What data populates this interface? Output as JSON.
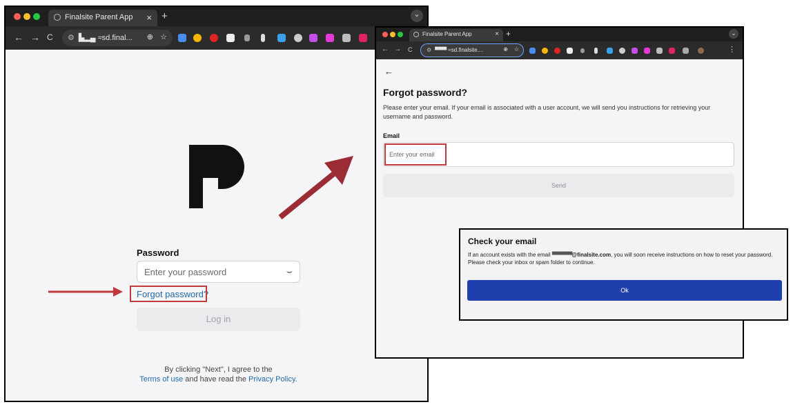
{
  "browser": {
    "tab_title": "Finalsite Parent App",
    "tab_close": "×",
    "new_tab": "+",
    "menu_chevron": "⌄",
    "url_left": "▙▂▄ ≈sd.final...",
    "url_right": "▀▀▀ ≈sd.finalsite....",
    "back_glyph": "←",
    "forward_glyph": "→",
    "reload_glyph": "C",
    "zoom_glyph": "⊕",
    "star_glyph": "☆",
    "kebab_glyph": "⋮"
  },
  "login": {
    "password_label": "Password",
    "password_placeholder": "Enter your password",
    "eye_glyph": "⌣",
    "forgot_link": "Forgot password?",
    "login_button": "Log in",
    "footer_line1": "By clicking \"Next\", I agree to the",
    "terms_link": "Terms of use",
    "footer_mid": " and have read the ",
    "privacy_link": "Privacy Policy",
    "footer_end": "."
  },
  "forgot": {
    "back_glyph": "←",
    "title": "Forgot password?",
    "description": "Please enter your email. If your email is associated with a user account, we will send you instructions for retrieving your username and password.",
    "email_label": "Email",
    "email_placeholder": "Enter your email",
    "send_button": "Send"
  },
  "check": {
    "title": "Check your email",
    "text_before": "If an account exists with the email ",
    "email_redacted": "▀▀▀'▀▀▀",
    "email_domain": "@finalsite.com",
    "text_after": ", you will soon receive instructions on how to reset your password. Please check your inbox or spam folder to continue.",
    "ok_button": "Ok"
  },
  "colors": {
    "accent_red": "#c0393b",
    "ok_blue": "#1f3fad",
    "link_blue": "#1e6aa8",
    "mac_red": "#ff5f57",
    "mac_yellow": "#febc2e",
    "mac_green": "#28c840"
  }
}
